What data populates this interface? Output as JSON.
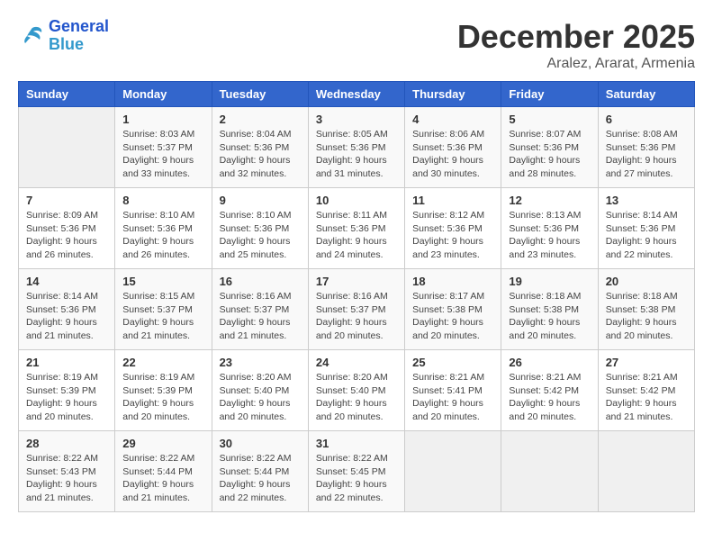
{
  "header": {
    "logo_line1": "General",
    "logo_line2": "Blue",
    "month_year": "December 2025",
    "location": "Aralez, Ararat, Armenia"
  },
  "weekdays": [
    "Sunday",
    "Monday",
    "Tuesday",
    "Wednesday",
    "Thursday",
    "Friday",
    "Saturday"
  ],
  "weeks": [
    [
      {
        "day": "",
        "sunrise": "",
        "sunset": "",
        "daylight": "",
        "empty": true
      },
      {
        "day": "1",
        "sunrise": "Sunrise: 8:03 AM",
        "sunset": "Sunset: 5:37 PM",
        "daylight": "Daylight: 9 hours and 33 minutes."
      },
      {
        "day": "2",
        "sunrise": "Sunrise: 8:04 AM",
        "sunset": "Sunset: 5:36 PM",
        "daylight": "Daylight: 9 hours and 32 minutes."
      },
      {
        "day": "3",
        "sunrise": "Sunrise: 8:05 AM",
        "sunset": "Sunset: 5:36 PM",
        "daylight": "Daylight: 9 hours and 31 minutes."
      },
      {
        "day": "4",
        "sunrise": "Sunrise: 8:06 AM",
        "sunset": "Sunset: 5:36 PM",
        "daylight": "Daylight: 9 hours and 30 minutes."
      },
      {
        "day": "5",
        "sunrise": "Sunrise: 8:07 AM",
        "sunset": "Sunset: 5:36 PM",
        "daylight": "Daylight: 9 hours and 28 minutes."
      },
      {
        "day": "6",
        "sunrise": "Sunrise: 8:08 AM",
        "sunset": "Sunset: 5:36 PM",
        "daylight": "Daylight: 9 hours and 27 minutes."
      }
    ],
    [
      {
        "day": "7",
        "sunrise": "Sunrise: 8:09 AM",
        "sunset": "Sunset: 5:36 PM",
        "daylight": "Daylight: 9 hours and 26 minutes."
      },
      {
        "day": "8",
        "sunrise": "Sunrise: 8:10 AM",
        "sunset": "Sunset: 5:36 PM",
        "daylight": "Daylight: 9 hours and 26 minutes."
      },
      {
        "day": "9",
        "sunrise": "Sunrise: 8:10 AM",
        "sunset": "Sunset: 5:36 PM",
        "daylight": "Daylight: 9 hours and 25 minutes."
      },
      {
        "day": "10",
        "sunrise": "Sunrise: 8:11 AM",
        "sunset": "Sunset: 5:36 PM",
        "daylight": "Daylight: 9 hours and 24 minutes."
      },
      {
        "day": "11",
        "sunrise": "Sunrise: 8:12 AM",
        "sunset": "Sunset: 5:36 PM",
        "daylight": "Daylight: 9 hours and 23 minutes."
      },
      {
        "day": "12",
        "sunrise": "Sunrise: 8:13 AM",
        "sunset": "Sunset: 5:36 PM",
        "daylight": "Daylight: 9 hours and 23 minutes."
      },
      {
        "day": "13",
        "sunrise": "Sunrise: 8:14 AM",
        "sunset": "Sunset: 5:36 PM",
        "daylight": "Daylight: 9 hours and 22 minutes."
      }
    ],
    [
      {
        "day": "14",
        "sunrise": "Sunrise: 8:14 AM",
        "sunset": "Sunset: 5:36 PM",
        "daylight": "Daylight: 9 hours and 21 minutes."
      },
      {
        "day": "15",
        "sunrise": "Sunrise: 8:15 AM",
        "sunset": "Sunset: 5:37 PM",
        "daylight": "Daylight: 9 hours and 21 minutes."
      },
      {
        "day": "16",
        "sunrise": "Sunrise: 8:16 AM",
        "sunset": "Sunset: 5:37 PM",
        "daylight": "Daylight: 9 hours and 21 minutes."
      },
      {
        "day": "17",
        "sunrise": "Sunrise: 8:16 AM",
        "sunset": "Sunset: 5:37 PM",
        "daylight": "Daylight: 9 hours and 20 minutes."
      },
      {
        "day": "18",
        "sunrise": "Sunrise: 8:17 AM",
        "sunset": "Sunset: 5:38 PM",
        "daylight": "Daylight: 9 hours and 20 minutes."
      },
      {
        "day": "19",
        "sunrise": "Sunrise: 8:18 AM",
        "sunset": "Sunset: 5:38 PM",
        "daylight": "Daylight: 9 hours and 20 minutes."
      },
      {
        "day": "20",
        "sunrise": "Sunrise: 8:18 AM",
        "sunset": "Sunset: 5:38 PM",
        "daylight": "Daylight: 9 hours and 20 minutes."
      }
    ],
    [
      {
        "day": "21",
        "sunrise": "Sunrise: 8:19 AM",
        "sunset": "Sunset: 5:39 PM",
        "daylight": "Daylight: 9 hours and 20 minutes."
      },
      {
        "day": "22",
        "sunrise": "Sunrise: 8:19 AM",
        "sunset": "Sunset: 5:39 PM",
        "daylight": "Daylight: 9 hours and 20 minutes."
      },
      {
        "day": "23",
        "sunrise": "Sunrise: 8:20 AM",
        "sunset": "Sunset: 5:40 PM",
        "daylight": "Daylight: 9 hours and 20 minutes."
      },
      {
        "day": "24",
        "sunrise": "Sunrise: 8:20 AM",
        "sunset": "Sunset: 5:40 PM",
        "daylight": "Daylight: 9 hours and 20 minutes."
      },
      {
        "day": "25",
        "sunrise": "Sunrise: 8:21 AM",
        "sunset": "Sunset: 5:41 PM",
        "daylight": "Daylight: 9 hours and 20 minutes."
      },
      {
        "day": "26",
        "sunrise": "Sunrise: 8:21 AM",
        "sunset": "Sunset: 5:42 PM",
        "daylight": "Daylight: 9 hours and 20 minutes."
      },
      {
        "day": "27",
        "sunrise": "Sunrise: 8:21 AM",
        "sunset": "Sunset: 5:42 PM",
        "daylight": "Daylight: 9 hours and 21 minutes."
      }
    ],
    [
      {
        "day": "28",
        "sunrise": "Sunrise: 8:22 AM",
        "sunset": "Sunset: 5:43 PM",
        "daylight": "Daylight: 9 hours and 21 minutes."
      },
      {
        "day": "29",
        "sunrise": "Sunrise: 8:22 AM",
        "sunset": "Sunset: 5:44 PM",
        "daylight": "Daylight: 9 hours and 21 minutes."
      },
      {
        "day": "30",
        "sunrise": "Sunrise: 8:22 AM",
        "sunset": "Sunset: 5:44 PM",
        "daylight": "Daylight: 9 hours and 22 minutes."
      },
      {
        "day": "31",
        "sunrise": "Sunrise: 8:22 AM",
        "sunset": "Sunset: 5:45 PM",
        "daylight": "Daylight: 9 hours and 22 minutes."
      },
      {
        "day": "",
        "sunrise": "",
        "sunset": "",
        "daylight": "",
        "empty": true
      },
      {
        "day": "",
        "sunrise": "",
        "sunset": "",
        "daylight": "",
        "empty": true
      },
      {
        "day": "",
        "sunrise": "",
        "sunset": "",
        "daylight": "",
        "empty": true
      }
    ]
  ]
}
